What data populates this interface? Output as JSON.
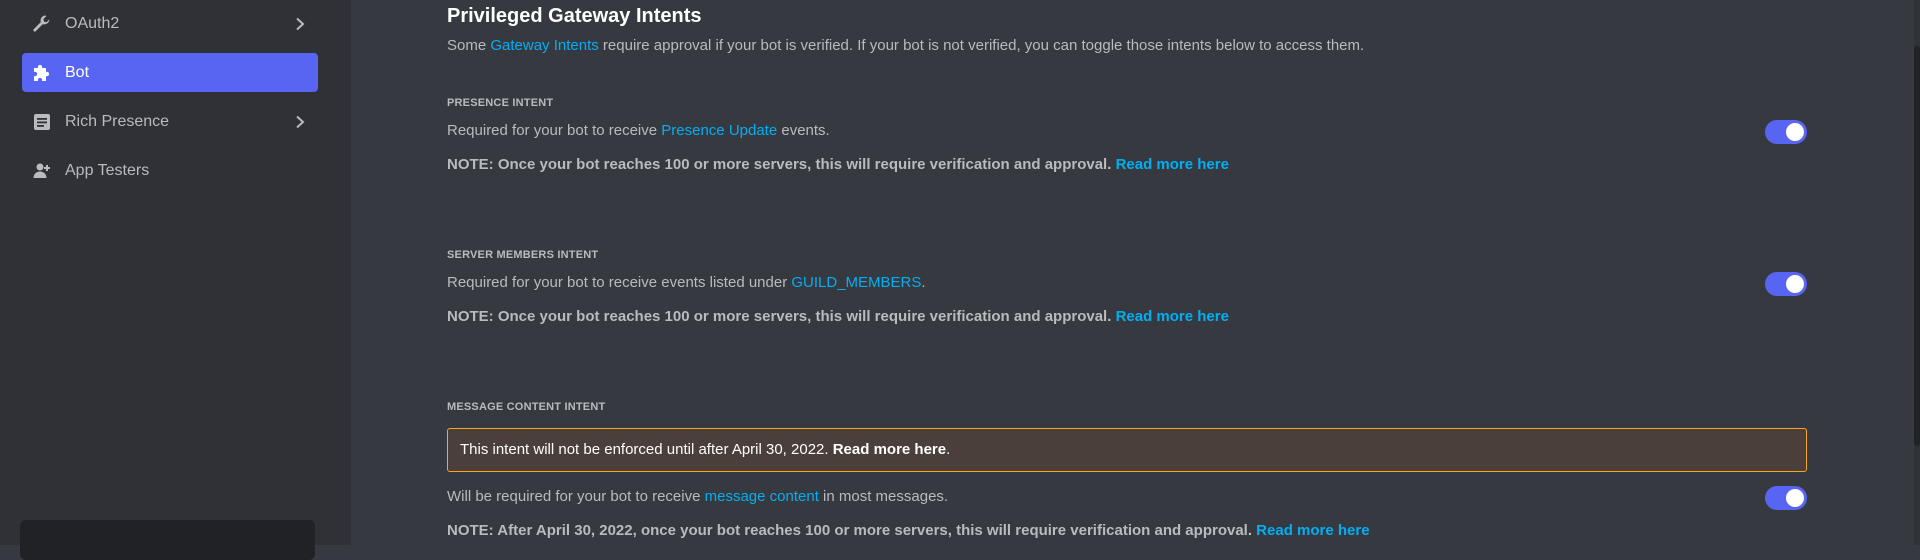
{
  "sidebar": {
    "items": [
      {
        "label": "OAuth2",
        "icon": "wrench-icon",
        "has_chevron": true,
        "active": false
      },
      {
        "label": "Bot",
        "icon": "puzzle-piece-icon",
        "has_chevron": false,
        "active": true
      },
      {
        "label": "Rich Presence",
        "icon": "document-icon",
        "has_chevron": true,
        "active": false
      },
      {
        "label": "App Testers",
        "icon": "person-add-icon",
        "has_chevron": false,
        "active": false
      }
    ]
  },
  "main": {
    "title": "Privileged Gateway Intents",
    "desc_pre": "Some ",
    "desc_link": "Gateway Intents",
    "desc_post": " require approval if your bot is verified. If your bot is not verified, you can toggle those intents below to access them.",
    "intents": [
      {
        "label": "PRESENCE INTENT",
        "desc_pre": "Required for your bot to receive ",
        "desc_link": "Presence Update",
        "desc_post": " events.",
        "note_text": "NOTE: Once your bot reaches 100 or more servers, this will require verification and approval. ",
        "note_link": "Read more here",
        "enabled": true
      },
      {
        "label": "SERVER MEMBERS INTENT",
        "desc_pre": "Required for your bot to receive events listed under ",
        "desc_link": "GUILD_MEMBERS",
        "desc_post": ".",
        "note_text": "NOTE: Once your bot reaches 100 or more servers, this will require verification and approval. ",
        "note_link": "Read more here",
        "enabled": true
      },
      {
        "label": "MESSAGE CONTENT INTENT",
        "warning_text": "This intent will not be enforced until after April 30, 2022. ",
        "warning_link": "Read more here",
        "warning_end": ".",
        "desc_pre": "Will be required for your bot to receive ",
        "desc_link": "message content",
        "desc_post": " in most messages.",
        "note_text": "NOTE: After April 30, 2022, once your bot reaches 100 or more servers, this will require verification and approval. ",
        "note_link": "Read more here",
        "enabled": true
      }
    ]
  },
  "colors": {
    "accent": "#5865f2",
    "link": "#00aff4",
    "warning_border": "#faa81a",
    "background": "#36393f",
    "sidebar": "#2f3136"
  }
}
